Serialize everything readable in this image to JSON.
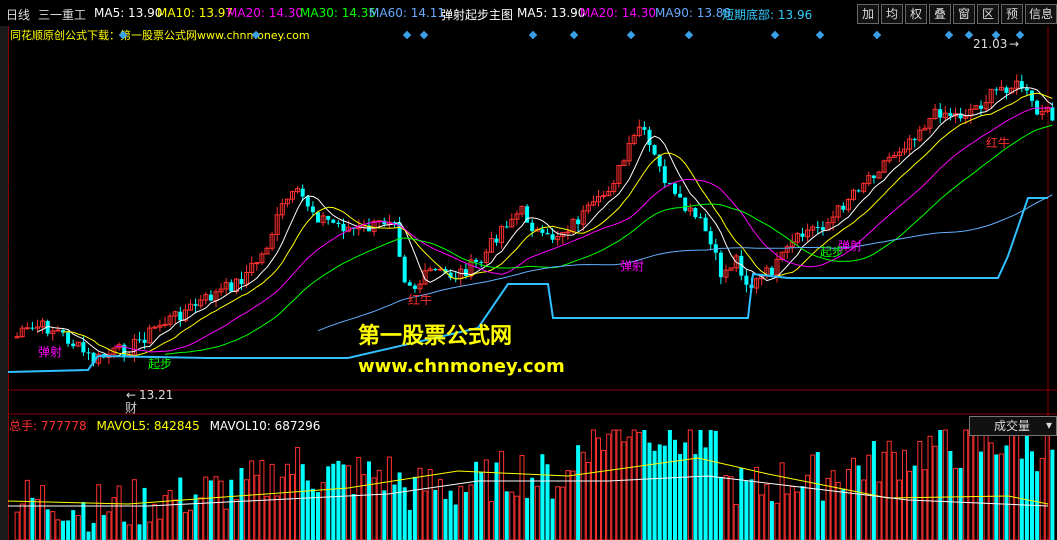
{
  "header": {
    "period": "日线",
    "stock_name": "三一重工",
    "ma5": "MA5: 13.90",
    "ma10": "MA10: 13.97",
    "ma20": "MA20: 14.30",
    "ma30": "MA30: 14.35",
    "ma60": "MA60: 14.11",
    "indicator_name": "弹射起步主图",
    "ind_ma5": "MA5: 13.90",
    "ind_ma20": "MA20: 14.30",
    "ind_ma90": "MA90: 13.88",
    "ind_bottom": "短期底部: 13.96"
  },
  "toolbar": [
    "加",
    "均",
    "权",
    "叠",
    "窗",
    "区",
    "预",
    "信息"
  ],
  "source_line": "同花顺原创公式下载：第一股票公式网www.chnmoney.com",
  "price_labels": {
    "high": "21.03",
    "low": "13.21"
  },
  "signals": [
    "弹射",
    "起步",
    "红牛",
    "财"
  ],
  "watermark": {
    "title": "第一股票公式网",
    "url": "www.chnmoney.com"
  },
  "volume": {
    "label": "总手: 777778",
    "mavol5": "MAVOL5: 842845",
    "mavol10": "MAVOL10: 687296",
    "indicator_select": "成交量"
  },
  "colors": {
    "up": "#ff3030",
    "down": "#00ffff",
    "ma5": "#ffffff",
    "ma10": "#ffff00",
    "ma20": "#ff00ff",
    "ma30": "#00ff00",
    "ma60": "#60b0ff",
    "bottom": "#30c0ff"
  }
}
